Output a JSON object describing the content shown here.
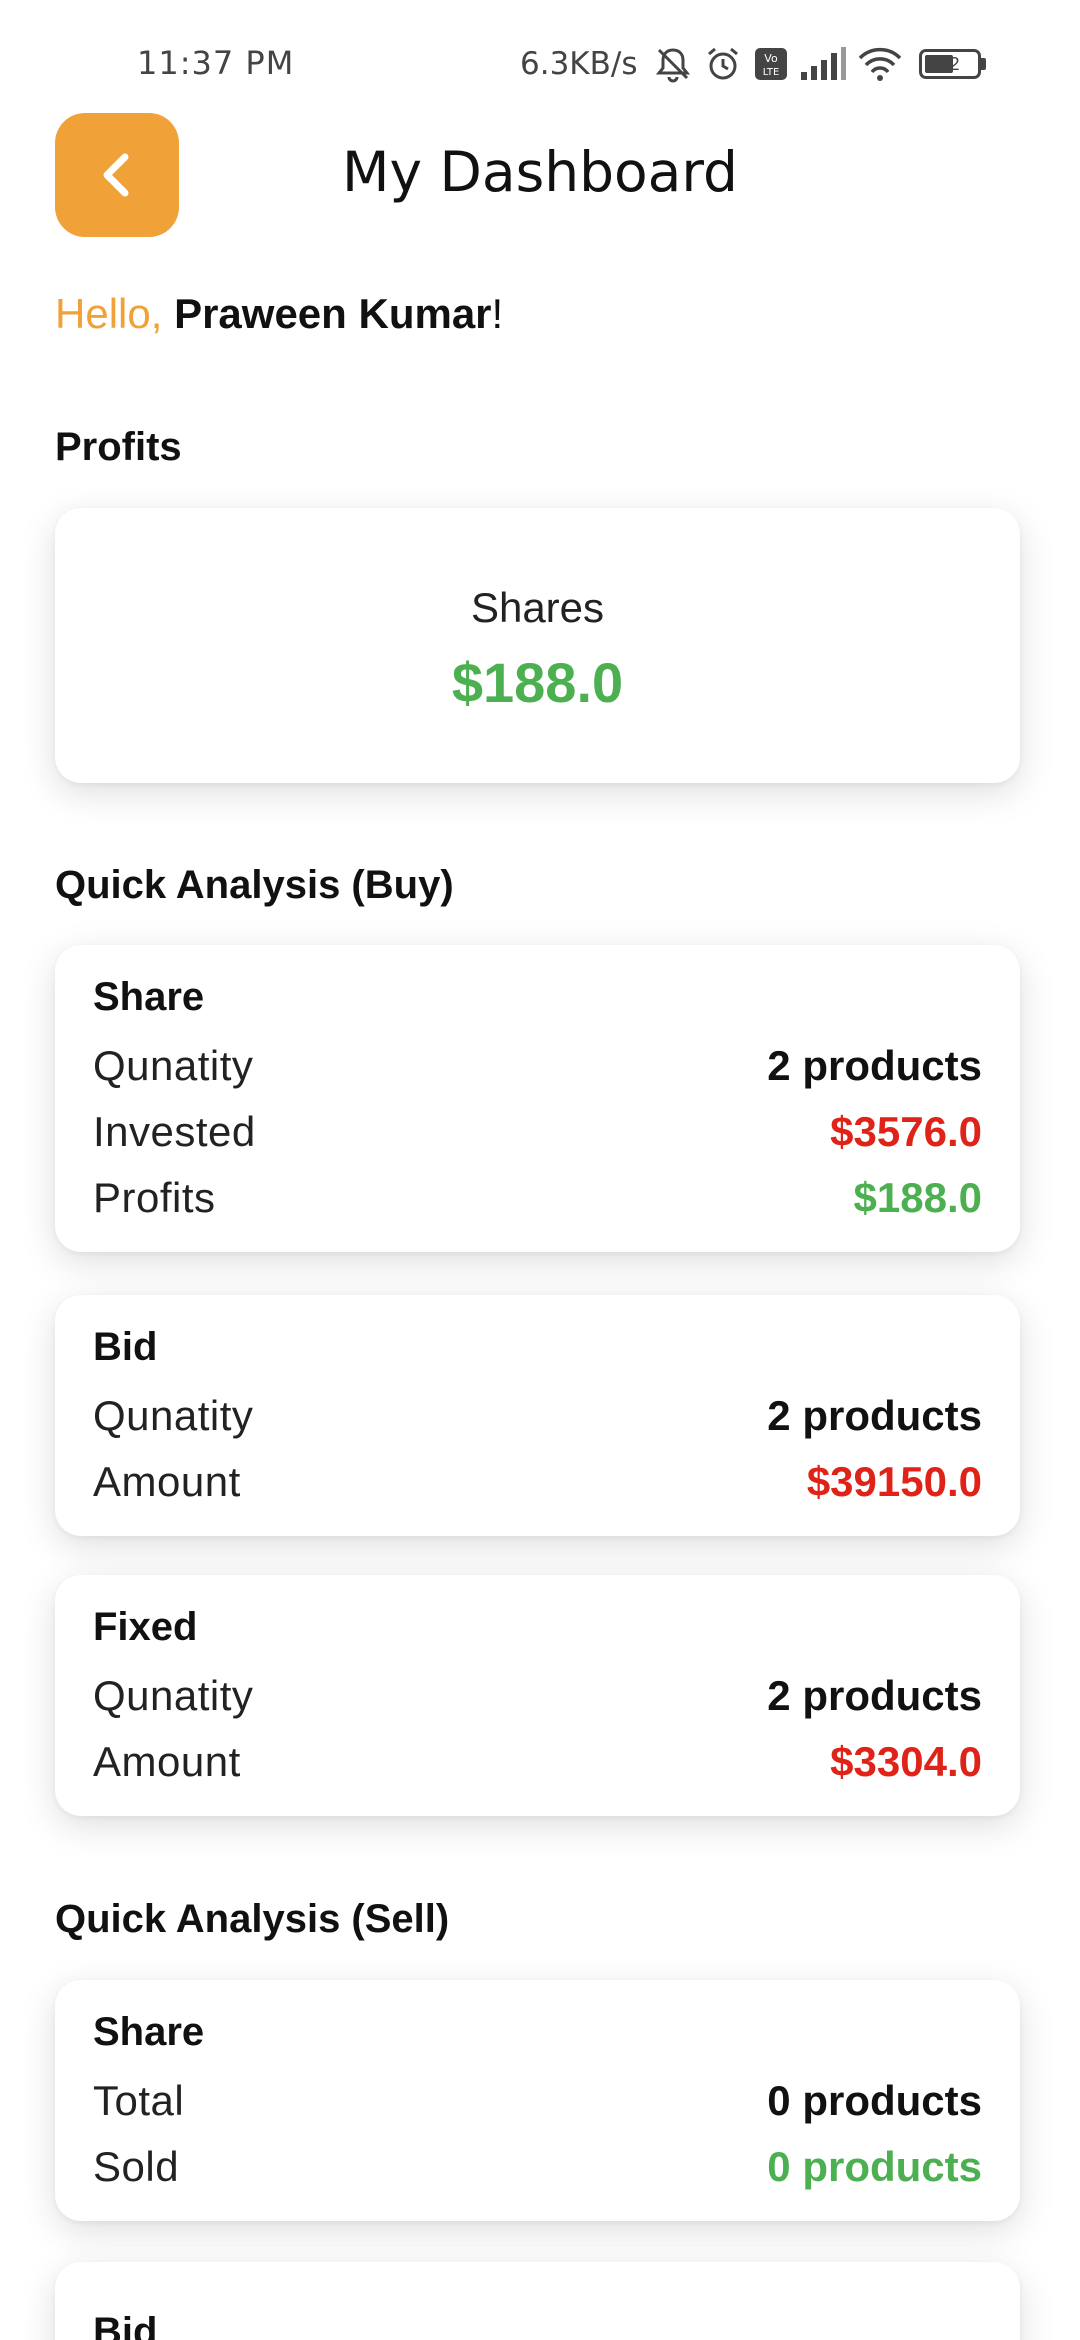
{
  "status": {
    "time": "11:37 PM",
    "net_speed": "6.3KB/s",
    "battery": "52",
    "icons": [
      "mute-icon",
      "alarm-icon",
      "volte-icon",
      "signal-icon",
      "wifi-icon",
      "battery-icon"
    ]
  },
  "header": {
    "title": "My Dashboard",
    "back_icon": "chevron-left-icon"
  },
  "greeting": {
    "hello": "Hello, ",
    "name": "Praween Kumar",
    "suffix": "!"
  },
  "profits": {
    "section_title": "Profits",
    "label": "Shares",
    "value": "$188.0"
  },
  "buy": {
    "section_title": "Quick Analysis (Buy)",
    "share": {
      "title": "Share",
      "rows": [
        {
          "label": "Qunatity",
          "value": "2 products"
        },
        {
          "label": "Invested",
          "value": "$3576.0"
        },
        {
          "label": "Profits",
          "value": "$188.0"
        }
      ]
    },
    "bid": {
      "title": "Bid",
      "rows": [
        {
          "label": "Qunatity",
          "value": "2 products"
        },
        {
          "label": "Amount",
          "value": "$39150.0"
        }
      ]
    },
    "fixed": {
      "title": "Fixed",
      "rows": [
        {
          "label": "Qunatity",
          "value": "2 products"
        },
        {
          "label": "Amount",
          "value": "$3304.0"
        }
      ]
    }
  },
  "sell": {
    "section_title": "Quick Analysis (Sell)",
    "share": {
      "title": "Share",
      "rows": [
        {
          "label": "Total",
          "value": "0 products"
        },
        {
          "label": "Sold",
          "value": "0 products"
        }
      ]
    },
    "bid": {
      "title": "Bid"
    }
  },
  "colors": {
    "accent": "#f0a137",
    "positive": "#4caf50",
    "negative": "#e02318"
  }
}
